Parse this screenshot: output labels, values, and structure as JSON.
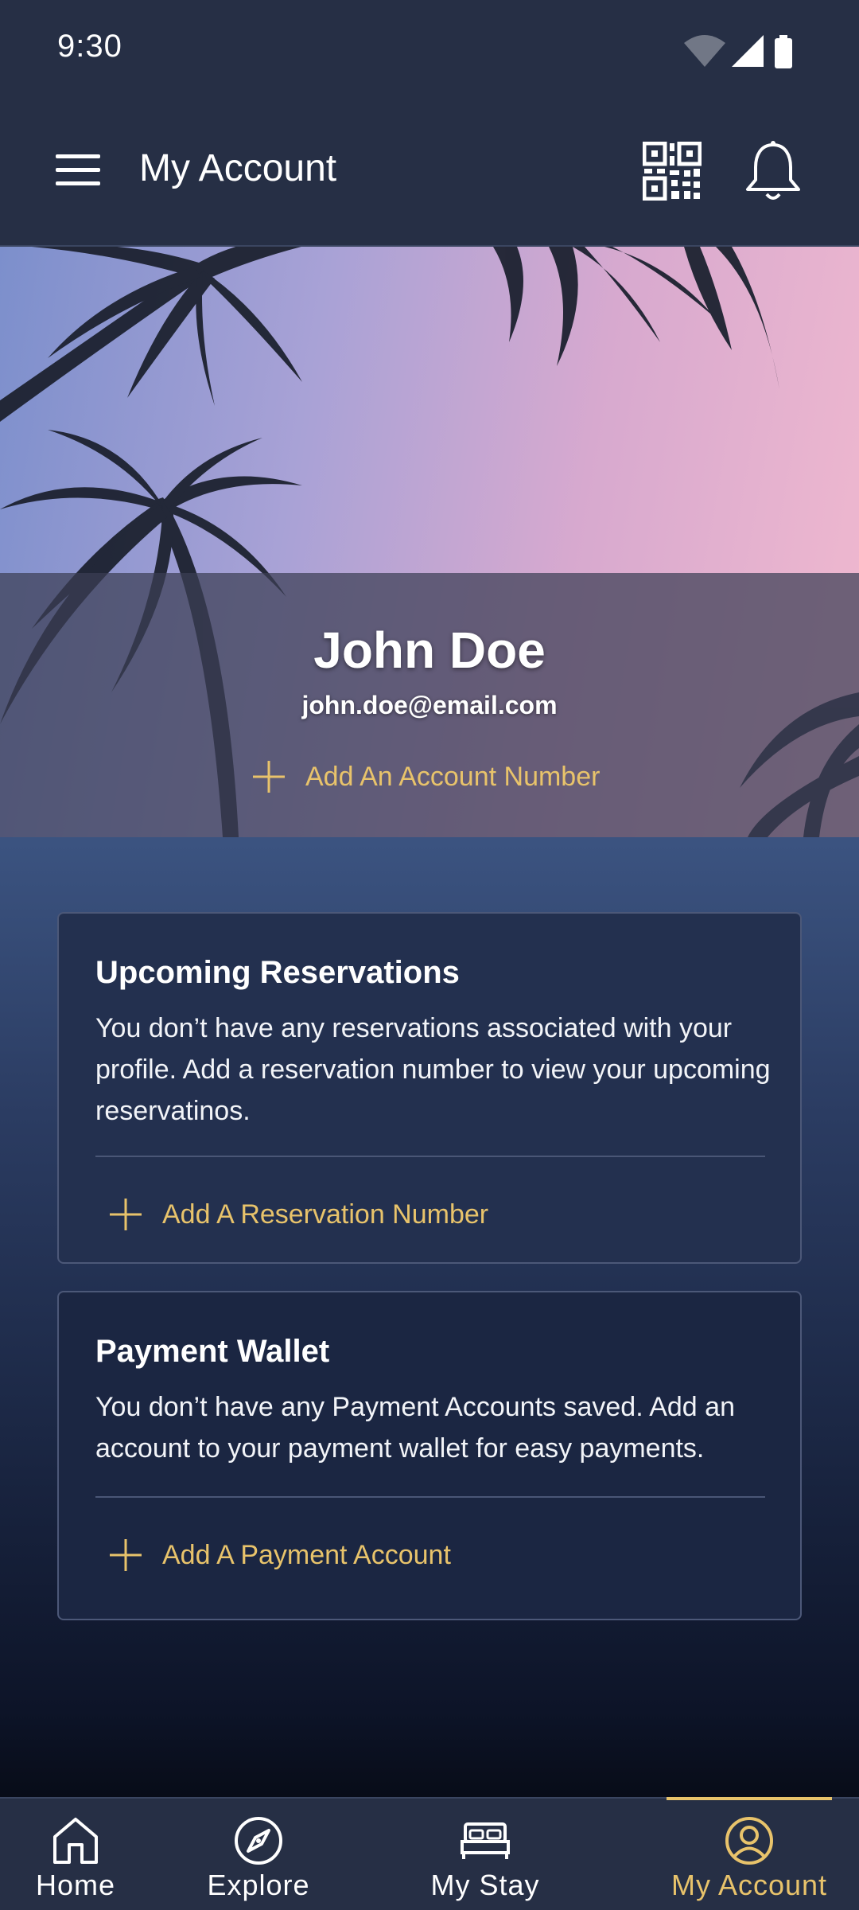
{
  "status_bar": {
    "time": "9:30"
  },
  "app_bar": {
    "title": "My Account"
  },
  "profile": {
    "name": "John Doe",
    "email": "john.doe@email.com",
    "add_account_label": "Add An Account Number"
  },
  "reservations": {
    "title": "Upcoming Reservations",
    "text": "You don’t have any reservations associated with your profile. Add a reservation number to view your upcoming reservatinos.",
    "action_label": "Add A Reservation Number"
  },
  "wallet": {
    "title": "Payment Wallet",
    "text": "You don’t have any Payment Accounts saved. Add an account to your payment wallet for easy payments.",
    "action_label": "Add A Payment Account"
  },
  "bottom_nav": {
    "items": [
      {
        "label": "Home",
        "icon": "home-icon",
        "active": false
      },
      {
        "label": "Explore",
        "icon": "compass-icon",
        "active": false
      },
      {
        "label": "My Stay",
        "icon": "bed-icon",
        "active": false
      },
      {
        "label": "My Account",
        "icon": "user-circle-icon",
        "active": true
      }
    ]
  },
  "colors": {
    "accent": "#e8c36b",
    "bar_background": "#262f45",
    "card_background": "#23304f"
  }
}
